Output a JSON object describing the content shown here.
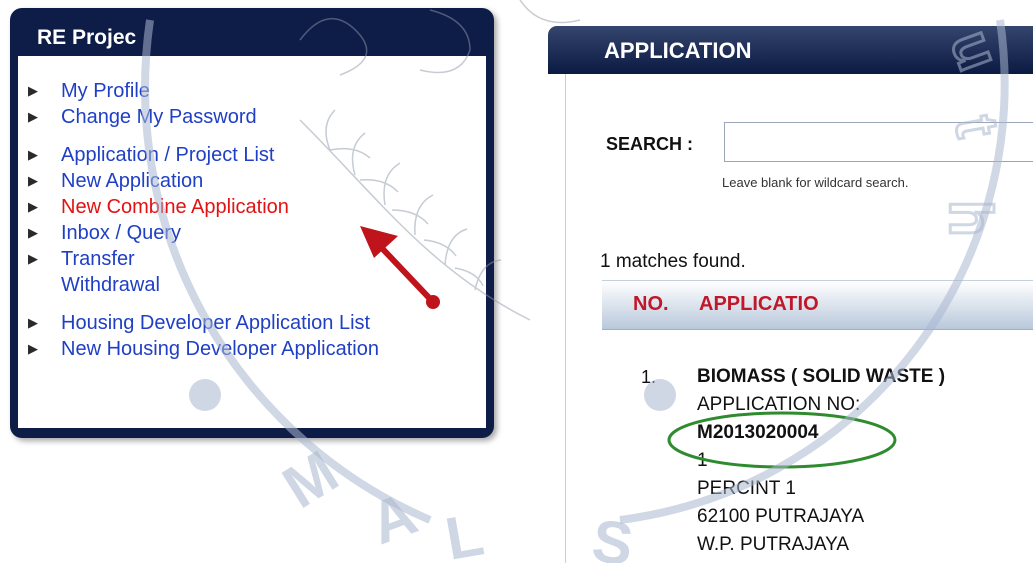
{
  "sidebar": {
    "title": "RE Projec",
    "items": [
      {
        "label": "My Profile"
      },
      {
        "label": "Change My Password"
      },
      {
        "label": "Application / Project List"
      },
      {
        "label": "New Application"
      },
      {
        "label": "New Combine Application"
      },
      {
        "label": "Inbox / Query"
      },
      {
        "label": "Transfer"
      },
      {
        "label": "Withdrawal"
      },
      {
        "label": "Housing Developer Application List"
      },
      {
        "label": "New Housing Developer Application"
      }
    ]
  },
  "main": {
    "header_title": "APPLICATION",
    "search": {
      "label": "SEARCH :",
      "value": "",
      "hint": "Leave blank for wildcard search."
    },
    "match_count_text": "1 matches found.",
    "table": {
      "headers": [
        "NO.",
        "APPLICATIO"
      ],
      "rows": [
        {
          "no": "1.",
          "lines": [
            "BIOMASS ( SOLID WASTE )",
            "APPLICATION NO:",
            "M2013020004",
            "1",
            "PERCINT 1",
            "62100 PUTRAJAYA",
            "W.P. PUTRAJAYA"
          ]
        }
      ]
    }
  },
  "annotations": {
    "arrow_color": "#c0141c",
    "highlight_color": "#2e8b2e"
  },
  "watermark": {
    "text": "Sustainable Energy Development Authority MALAYSIA",
    "color": "#a9b7cf"
  }
}
